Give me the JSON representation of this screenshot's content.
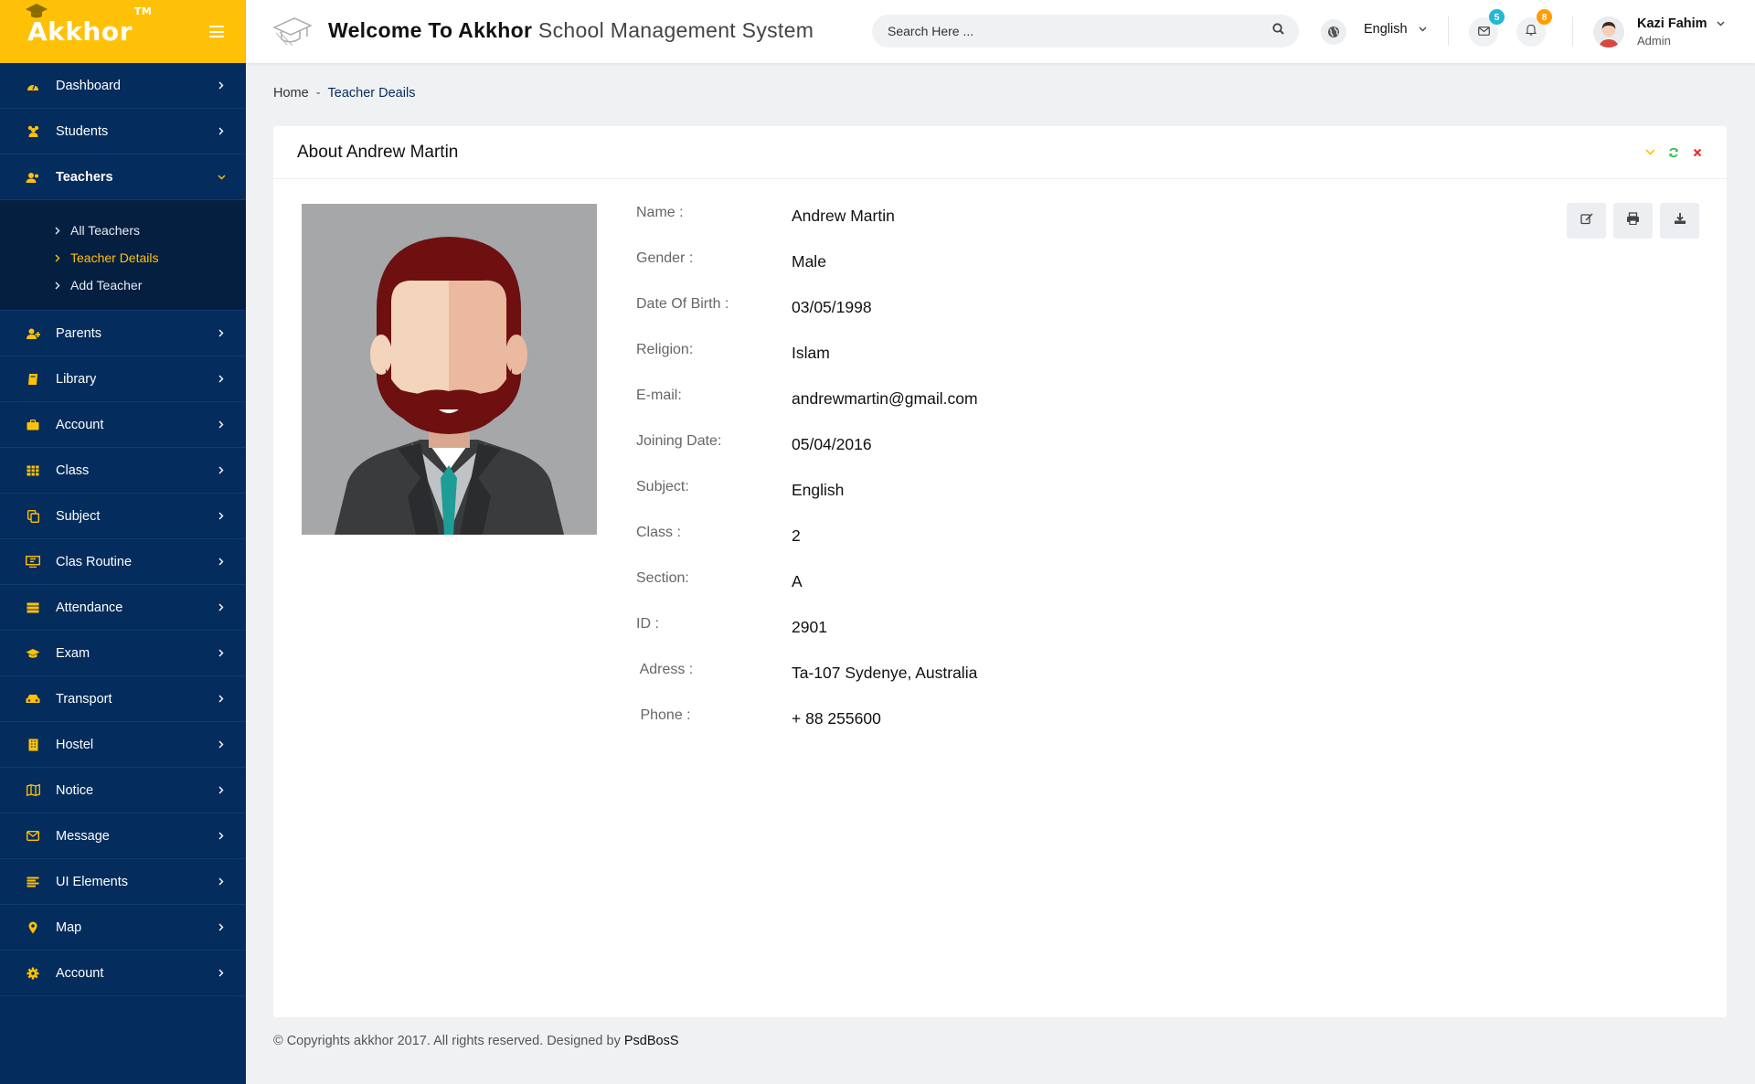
{
  "brand": {
    "name": "Akkhor",
    "tm": "TM"
  },
  "sidebar": {
    "items": [
      {
        "label": "Dashboard",
        "icon": "dashboard-icon"
      },
      {
        "label": "Students",
        "icon": "students-icon"
      },
      {
        "label": "Teachers",
        "icon": "teachers-icon"
      },
      {
        "label": "Parents",
        "icon": "parents-icon"
      },
      {
        "label": "Library",
        "icon": "book-icon"
      },
      {
        "label": "Account",
        "icon": "briefcase-icon"
      },
      {
        "label": "Class",
        "icon": "table-icon"
      },
      {
        "label": "Subject",
        "icon": "copy-icon"
      },
      {
        "label": "Clas Routine",
        "icon": "routine-icon"
      },
      {
        "label": "Attendance",
        "icon": "list-icon"
      },
      {
        "label": "Exam",
        "icon": "graduation-cap-icon"
      },
      {
        "label": "Transport",
        "icon": "car-icon"
      },
      {
        "label": "Hostel",
        "icon": "building-icon"
      },
      {
        "label": "Notice",
        "icon": "map-icon"
      },
      {
        "label": "Message",
        "icon": "envelope-icon"
      },
      {
        "label": "UI Elements",
        "icon": "align-icon"
      },
      {
        "label": "Map",
        "icon": "map-pin-icon"
      },
      {
        "label": "Account",
        "icon": "gear-icon"
      }
    ],
    "teachers_submenu": [
      {
        "label": "All Teachers"
      },
      {
        "label": "Teacher Details"
      },
      {
        "label": "Add Teacher"
      }
    ]
  },
  "header": {
    "welcome_bold": "Welcome To Akkhor",
    "welcome_rest": "School Management System",
    "search_placeholder": "Search Here ...",
    "language": "English",
    "messages_count": "5",
    "notifications_count": "8",
    "user_name": "Kazi Fahim",
    "user_role": "Admin"
  },
  "breadcrumb": {
    "home": "Home",
    "separator": "-",
    "current": "Teacher Deails"
  },
  "card": {
    "title": "About Andrew Martin",
    "fields": [
      {
        "label": "Name :",
        "value": "Andrew Martin"
      },
      {
        "label": "Gender :",
        "value": "Male"
      },
      {
        "label": "Date Of Birth :",
        "value": "03/05/1998"
      },
      {
        "label": "Religion:",
        "value": "Islam"
      },
      {
        "label": "E-mail:",
        "value": "andrewmartin@gmail.com"
      },
      {
        "label": "Joining Date:",
        "value": "05/04/2016"
      },
      {
        "label": "Subject:",
        "value": "English"
      },
      {
        "label": "Class :",
        "value": "2"
      },
      {
        "label": "Section:",
        "value": "A"
      },
      {
        "label": "ID :",
        "value": "2901"
      },
      {
        "label": " Adress :",
        "value": "Ta-107 Sydenye, Australia"
      },
      {
        "label": " Phone :",
        "value": "+ 88 255600"
      }
    ]
  },
  "footer": {
    "text": "© Copyrights akkhor 2017. All rights reserved. Designed by",
    "designer": "PsdBosS"
  },
  "colors": {
    "sidebar": "#042c5c",
    "accent": "#ffc107",
    "msg_badge": "#22b7d8",
    "notif_badge": "#ff9d01",
    "refresh": "#2ec44a",
    "close": "#e83131"
  }
}
